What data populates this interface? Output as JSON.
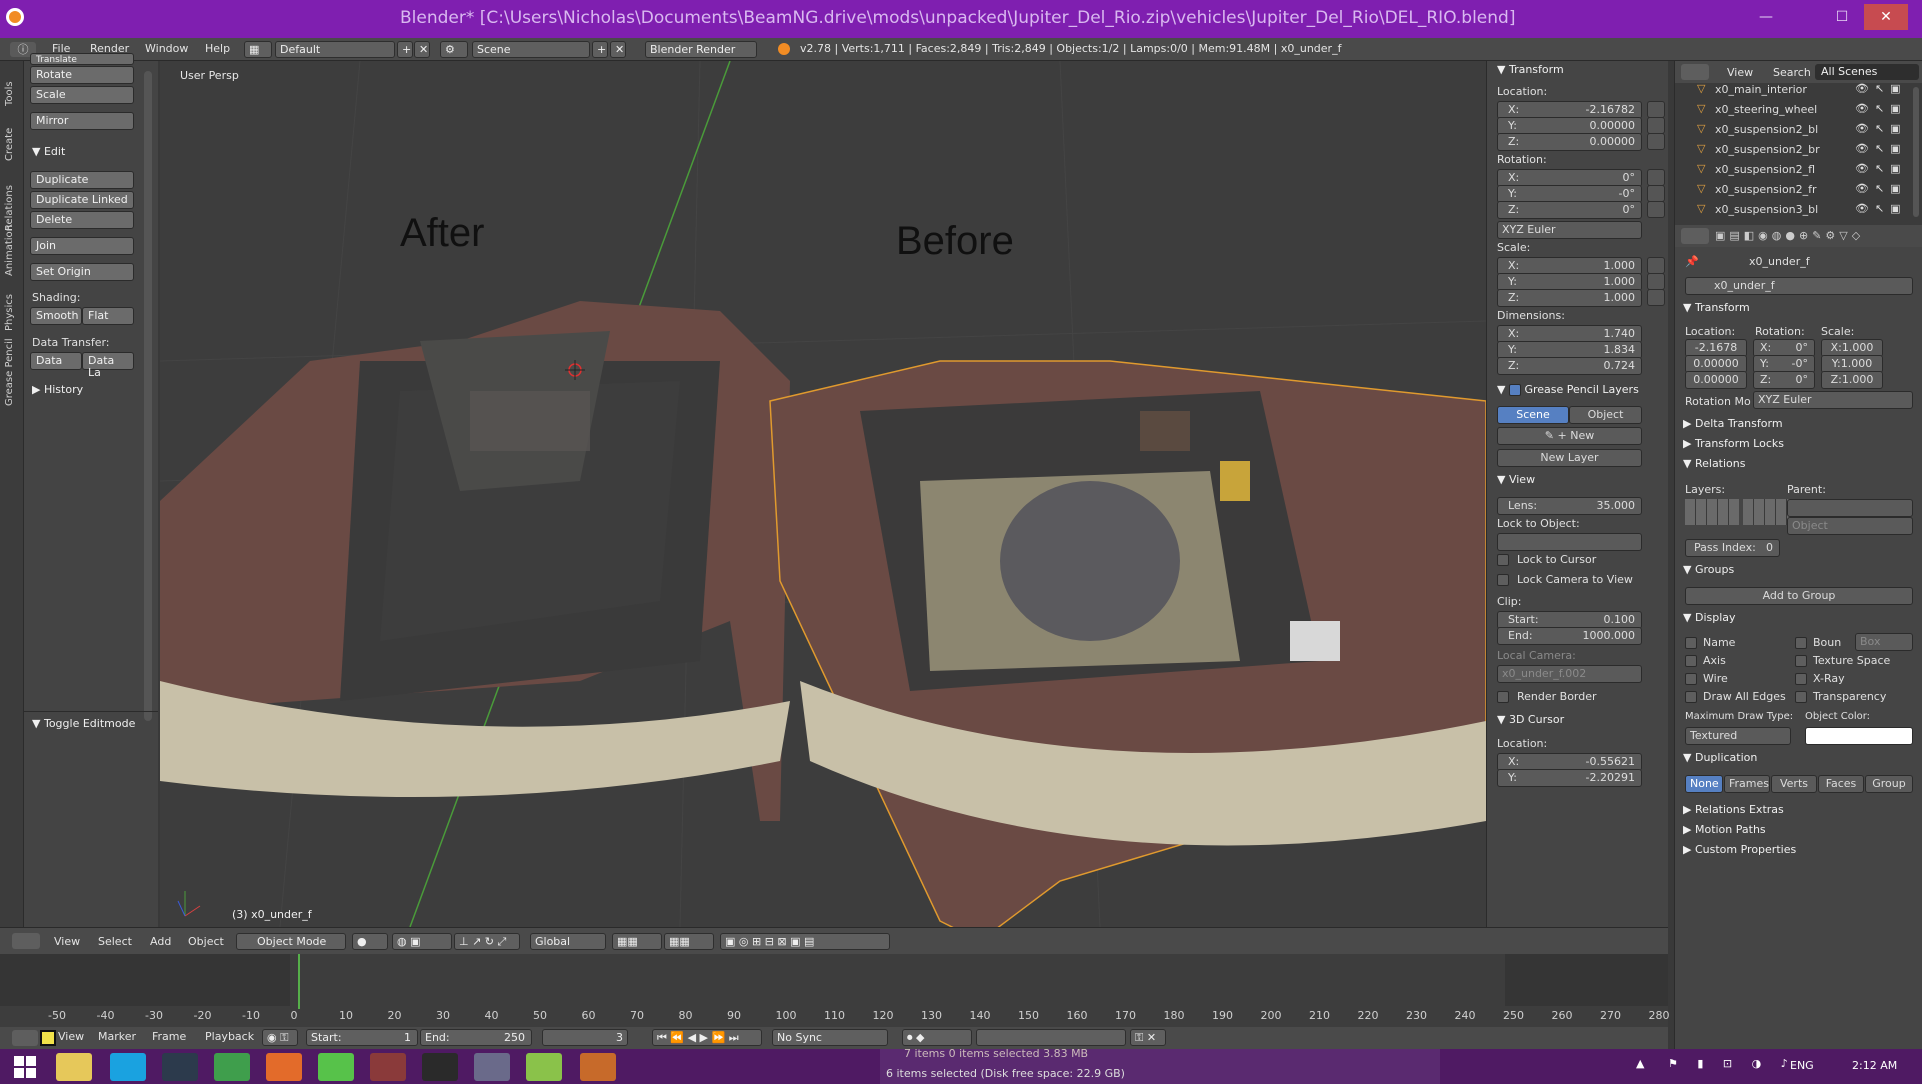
{
  "window": {
    "title": "Blender* [C:\\Users\\Nicholas\\Documents\\BeamNG.drive\\mods\\unpacked\\Jupiter_Del_Rio.zip\\vehicles\\Jupiter_Del_Rio\\DEL_RIO.blend]",
    "minimize": "—",
    "maximize": "☐",
    "close": "✕"
  },
  "info": {
    "menus": [
      "File",
      "Render",
      "Window",
      "Help"
    ],
    "layout": "Default",
    "scene": "Scene",
    "engine": "Blender Render",
    "stats": "v2.78 | Verts:1,711 | Faces:2,849 | Tris:2,849 | Objects:1/2 | Lamps:0/0 | Mem:91.48M | x0_under_f"
  },
  "tabs": [
    "Tools",
    "Create",
    "Relations",
    "Animation",
    "Physics",
    "Grease Pencil"
  ],
  "toolshelf": {
    "cut": "Translate",
    "rotate": "Rotate",
    "scale": "Scale",
    "mirror": "Mirror",
    "edit_header": "Edit",
    "duplicate": "Duplicate",
    "duplicate_linked": "Duplicate Linked",
    "delete": "Delete",
    "join": "Join",
    "set_origin": "Set Origin",
    "shading_label": "Shading:",
    "smooth": "Smooth",
    "flat": "Flat",
    "data_transfer_label": "Data Transfer:",
    "data": "Data",
    "data_la": "Data La",
    "history": "History",
    "toggle_editmode": "Toggle Editmode"
  },
  "viewport": {
    "persp": "User Persp",
    "label_after": "After",
    "label_before": "Before",
    "object_info": "(3) x0_under_f"
  },
  "npanel": {
    "transform": "Transform",
    "location": "Location:",
    "loc": [
      [
        "X:",
        "-2.16782"
      ],
      [
        "Y:",
        "0.00000"
      ],
      [
        "Z:",
        "0.00000"
      ]
    ],
    "rotation": "Rotation:",
    "rot": [
      [
        "X:",
        "0°"
      ],
      [
        "Y:",
        "-0°"
      ],
      [
        "Z:",
        "0°"
      ]
    ],
    "rot_mode": "XYZ Euler",
    "scale": "Scale:",
    "scl": [
      [
        "X:",
        "1.000"
      ],
      [
        "Y:",
        "1.000"
      ],
      [
        "Z:",
        "1.000"
      ]
    ],
    "dimensions": "Dimensions:",
    "dim": [
      [
        "X:",
        "1.740"
      ],
      [
        "Y:",
        "1.834"
      ],
      [
        "Z:",
        "0.724"
      ]
    ],
    "gp_layers": "Grease Pencil Layers",
    "scene_btn": "Scene",
    "object_btn": "Object",
    "new": "New",
    "new_layer": "New Layer",
    "view": "View",
    "lens_k": "Lens:",
    "lens_v": "35.000",
    "lock_to_object": "Lock to Object:",
    "lock_to_cursor": "Lock to Cursor",
    "lock_camera": "Lock Camera to View",
    "clip": "Clip:",
    "clip_start_k": "Start:",
    "clip_start_v": "0.100",
    "clip_end_k": "End:",
    "clip_end_v": "1000.000",
    "local_camera": "Local Camera:",
    "local_camera_val": "x0_under_f.002",
    "render_border": "Render Border",
    "cursor": "3D Cursor",
    "cursor_loc": "Location:",
    "cur": [
      [
        "X:",
        "-0.55621"
      ],
      [
        "Y:",
        "-2.20291"
      ]
    ]
  },
  "outliner": {
    "menus": [
      "View",
      "Search"
    ],
    "scope": "All Scenes",
    "rows": [
      "x0_main_interior",
      "x0_steering_wheel",
      "x0_suspension2_bl",
      "x0_suspension2_br",
      "x0_suspension2_fl",
      "x0_suspension2_fr",
      "x0_suspension3_bl"
    ]
  },
  "props": {
    "object_name_crumb": "x0_under_f",
    "object_name": "x0_under_f",
    "transform": "Transform",
    "location": "Location:",
    "rotation": "Rotation:",
    "scale": "Scale:",
    "loc": [
      "-2.1678",
      "0.00000",
      "0.00000"
    ],
    "rot": [
      [
        "X:",
        "0°"
      ],
      [
        "Y:",
        "-0°"
      ],
      [
        "Z:",
        "0°"
      ]
    ],
    "scl": [
      "X:1.000",
      "Y:1.000",
      "Z:1.000"
    ],
    "rotation_mode_label": "Rotation Mo",
    "rotation_mode": "XYZ Euler",
    "delta": "Delta Transform",
    "locks": "Transform Locks",
    "relations": "Relations",
    "layers": "Layers:",
    "parent": "Parent:",
    "parent_type": "Object",
    "pass_index_k": "Pass Index:",
    "pass_index_v": "0",
    "groups": "Groups",
    "add_to_group": "Add to Group",
    "display": "Display",
    "name": "Name",
    "bounds": "Boun",
    "bounds_type": "Box",
    "axis": "Axis",
    "texture_space": "Texture Space",
    "wire": "Wire",
    "xray": "X-Ray",
    "draw_all_edges": "Draw All Edges",
    "transparency": "Transparency",
    "max_draw_type": "Maximum Draw Type:",
    "object_color": "Object Color:",
    "draw_type": "Textured",
    "duplication": "Duplication",
    "dup_opts": [
      "None",
      "Frames",
      "Verts",
      "Faces",
      "Group"
    ],
    "relations_extras": "Relations Extras",
    "motion_paths": "Motion Paths",
    "custom_props": "Custom Properties"
  },
  "vhdr": {
    "menus": [
      "View",
      "Select",
      "Add",
      "Object"
    ],
    "mode": "Object Mode",
    "orientation": "Global"
  },
  "timeline": {
    "ticks": [
      "-50",
      "-40",
      "-30",
      "-20",
      "-10",
      "0",
      "10",
      "20",
      "30",
      "40",
      "50",
      "60",
      "70",
      "80",
      "90",
      "100",
      "110",
      "120",
      "130",
      "140",
      "150",
      "160",
      "170",
      "180",
      "190",
      "200",
      "210",
      "220",
      "230",
      "240",
      "250",
      "260",
      "270",
      "280"
    ],
    "menus": [
      "View",
      "Marker",
      "Frame",
      "Playback"
    ],
    "start_k": "Start:",
    "start_v": "1",
    "end_k": "End:",
    "end_v": "250",
    "current": "3",
    "sync": "No Sync"
  },
  "taskbar": {
    "explorer_peek": "7 items      0 items selected  3.83 MB",
    "status_text": "6 items selected (Disk free space: 22.9 GB)",
    "lang": "ENG",
    "time": "2:12 AM"
  },
  "colors": {
    "accent_blue": "#5680c2",
    "title_purple": "#7f1fb0",
    "selection_orange": "#e09a2e"
  }
}
